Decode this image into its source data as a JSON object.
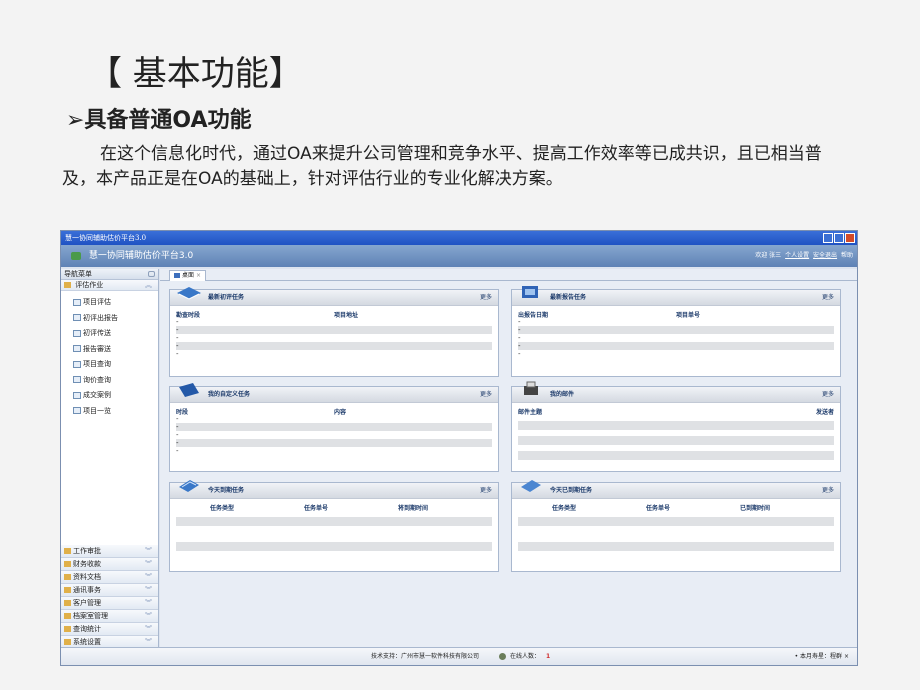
{
  "slide": {
    "title": "【 基本功能】",
    "subtitle": "➢具备普通OA功能",
    "paragraph": "在这个信息化时代，通过OA来提升公司管理和竞争水平、提高工作效率等已成共识，且已相当普及，本产品正是在OA的基础上，针对评估行业的专业化解决方案。"
  },
  "window": {
    "title": "慧一协同辅助估价平台3.0",
    "app_title": "慧一协同辅助估价平台3.0",
    "header_links": [
      "欢迎 张三",
      "个人设置",
      "安全退出",
      "帮助"
    ]
  },
  "sidebar": {
    "header": "导航菜单",
    "top_group": "评估作业",
    "items": [
      {
        "label": "项目评估",
        "icon": "document-icon"
      },
      {
        "label": "初评出报告",
        "icon": "report-icon"
      },
      {
        "label": "初评传送",
        "icon": "send-icon"
      },
      {
        "label": "报告審送",
        "icon": "review-icon"
      },
      {
        "label": "项目查询",
        "icon": "search-icon"
      },
      {
        "label": "询价查询",
        "icon": "price-icon"
      },
      {
        "label": "成交案例",
        "icon": "case-icon"
      },
      {
        "label": "项目一览",
        "icon": "list-icon"
      }
    ],
    "bottom_groups": [
      "工作审批",
      "财务收款",
      "资料文档",
      "通讯事务",
      "客户管理",
      "档案室管理",
      "查询统计",
      "系统设置"
    ]
  },
  "tabs": [
    {
      "label": "桌面"
    }
  ],
  "panels": [
    {
      "id": "latest-prelim",
      "title": "最新初评任务",
      "more": "更多",
      "columns": [
        "勘查时段",
        "项目地址"
      ],
      "rows": [
        "-",
        "-",
        "-",
        "-",
        "-"
      ]
    },
    {
      "id": "latest-report",
      "title": "最新报告任务",
      "more": "更多",
      "columns": [
        "出报告日期",
        "项目单号"
      ],
      "rows": [
        "-",
        "-",
        "-",
        "-",
        "-"
      ]
    },
    {
      "id": "custom-tasks",
      "title": "我的自定义任务",
      "more": "更多",
      "columns": [
        "时段",
        "内容"
      ],
      "rows": [
        "-",
        "-",
        "-",
        "-",
        "-"
      ]
    },
    {
      "id": "my-mail",
      "title": "我的邮件",
      "more": "更多",
      "columns": [
        "邮件主题",
        "发送者"
      ],
      "rows": []
    },
    {
      "id": "due-today",
      "title": "今天到期任务",
      "more": "更多",
      "columns": [
        "任务类型",
        "任务单号",
        "将到期时间"
      ],
      "rows": []
    },
    {
      "id": "overdue-today",
      "title": "今天已到期任务",
      "more": "更多",
      "columns": [
        "任务类型",
        "任务单号",
        "已到期时间"
      ],
      "rows": []
    }
  ],
  "status": {
    "support": "技术支持：广州市慧一软件科技有限公司",
    "online_label": "在线人数：",
    "online_count": "1",
    "right": "• 本月寿星：程群 ×"
  }
}
